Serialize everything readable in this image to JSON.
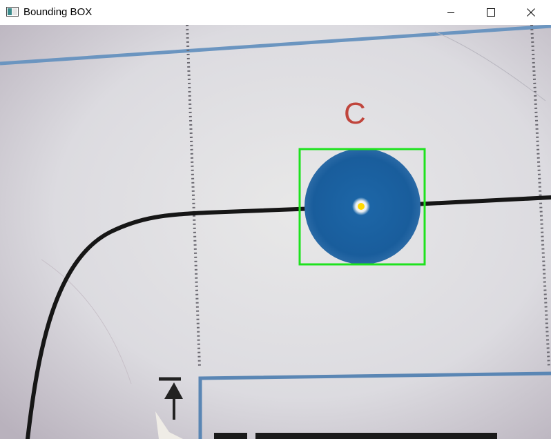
{
  "window": {
    "title": "Bounding BOX",
    "controls": {
      "minimize": "minimize-icon",
      "maximize": "maximize-icon",
      "close": "close-icon"
    }
  },
  "camera_view": {
    "paper_letter": "C",
    "colors": {
      "paper": "#dfdde3",
      "detected_blob": "#1a5e9e",
      "bounding_box": "#1ee21e",
      "center_marker": "#ffd800",
      "track_line": "#151515",
      "printed_border": "#5a86b4",
      "letter": "#c0453c"
    }
  }
}
